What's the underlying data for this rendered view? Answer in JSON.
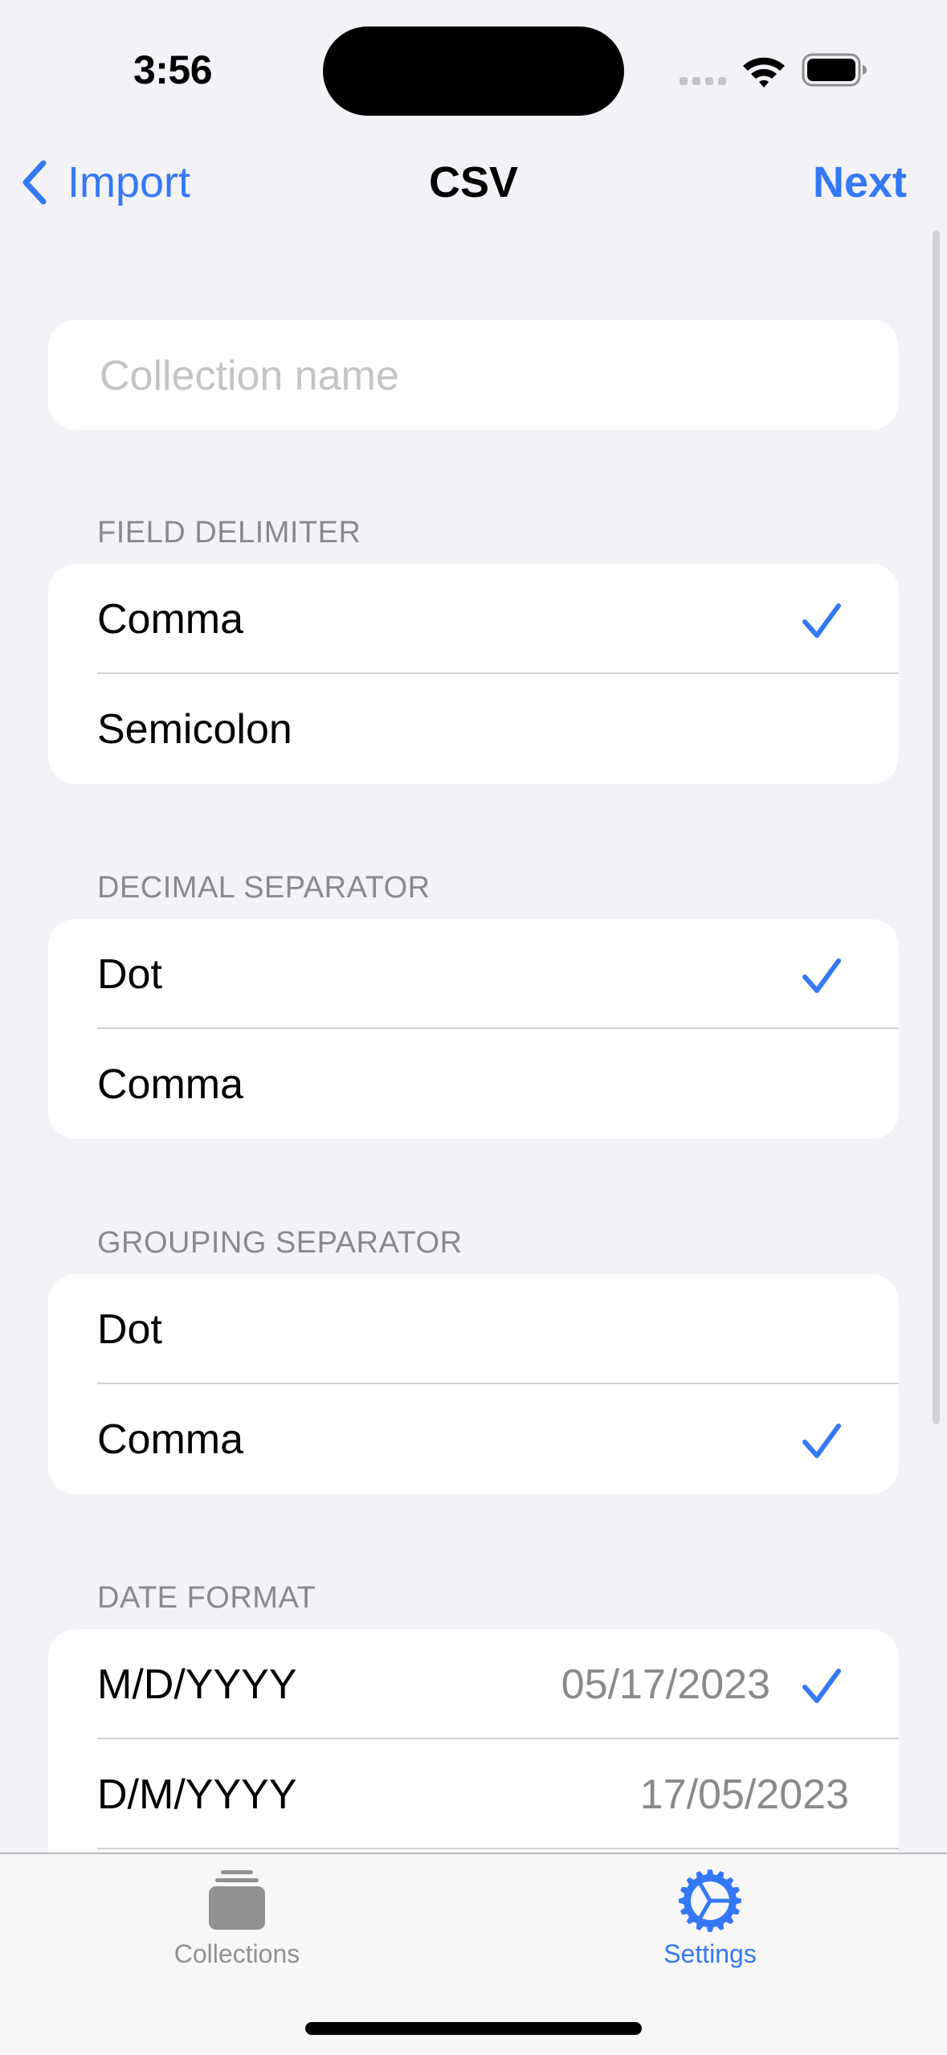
{
  "status_bar": {
    "time": "3:56",
    "signal_icon": "cellular-signal-icon",
    "wifi_icon": "wifi-icon",
    "battery_icon": "battery-icon"
  },
  "nav": {
    "back_label": "Import",
    "back_icon": "chevron-left-icon",
    "title": "CSV",
    "next_label": "Next"
  },
  "name_field": {
    "value": "",
    "placeholder": "Collection name"
  },
  "sections": [
    {
      "header": "FIELD DELIMITER",
      "options": [
        {
          "label": "Comma",
          "selected": true
        },
        {
          "label": "Semicolon",
          "selected": false
        }
      ]
    },
    {
      "header": "DECIMAL SEPARATOR",
      "options": [
        {
          "label": "Dot",
          "selected": true
        },
        {
          "label": "Comma",
          "selected": false
        }
      ]
    },
    {
      "header": "GROUPING SEPARATOR",
      "options": [
        {
          "label": "Dot",
          "selected": false
        },
        {
          "label": "Comma",
          "selected": true
        }
      ]
    },
    {
      "header": "DATE FORMAT",
      "options": [
        {
          "label": "M/D/YYYY",
          "detail": "05/17/2023",
          "selected": true
        },
        {
          "label": "D/M/YYYY",
          "detail": "17/05/2023",
          "selected": false
        }
      ]
    }
  ],
  "tab_bar": {
    "tabs": [
      {
        "label": "Collections",
        "icon": "collections-icon",
        "active": false
      },
      {
        "label": "Settings",
        "icon": "gear-icon",
        "active": true
      }
    ]
  },
  "colors": {
    "accent": "#3478F6",
    "background": "#F2F2F7",
    "secondary_text": "#8A8A8E",
    "inactive_tab": "#929292"
  }
}
